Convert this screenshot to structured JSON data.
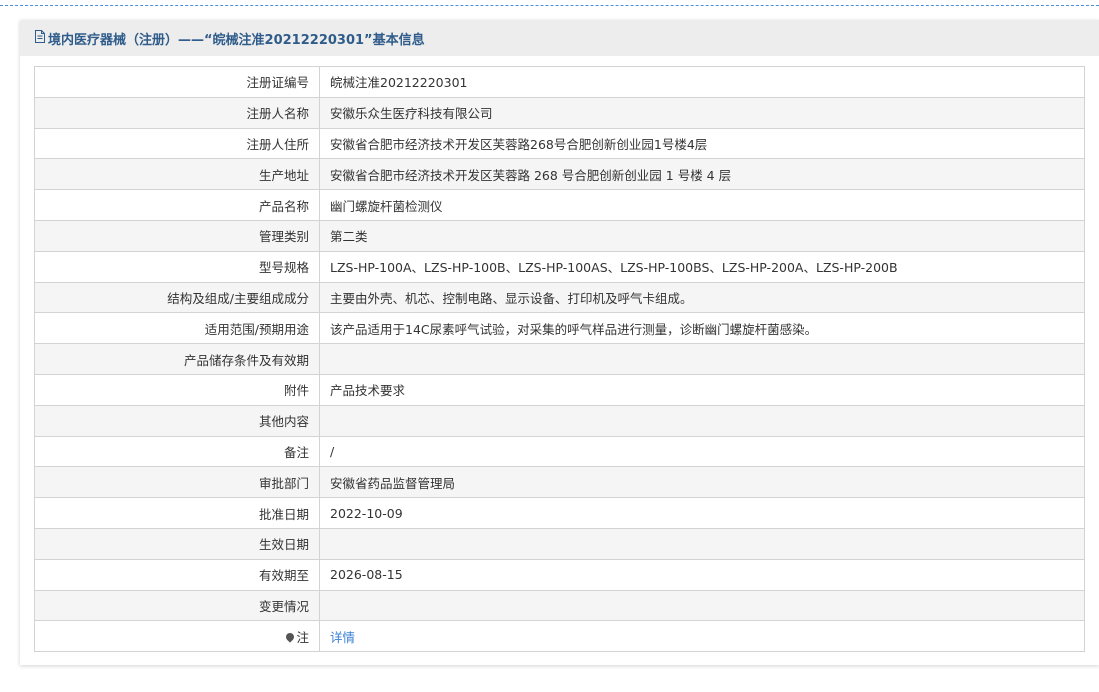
{
  "header": {
    "title": "境内医疗器械（注册）——“皖械注准20212220301”基本信息",
    "icon": "document-icon"
  },
  "rows": [
    {
      "label": "注册证编号",
      "value": "皖械注准20212220301"
    },
    {
      "label": "注册人名称",
      "value": "安徽乐众生医疗科技有限公司"
    },
    {
      "label": "注册人住所",
      "value": "安徽省合肥市经济技术开发区芙蓉路268号合肥创新创业园1号楼4层"
    },
    {
      "label": "生产地址",
      "value": "安徽省合肥市经济技术开发区芙蓉路 268 号合肥创新创业园 1 号楼 4 层"
    },
    {
      "label": "产品名称",
      "value": "幽门螺旋杆菌检测仪"
    },
    {
      "label": "管理类别",
      "value": "第二类"
    },
    {
      "label": "型号规格",
      "value": "LZS-HP-100A、LZS-HP-100B、LZS-HP-100AS、LZS-HP-100BS、LZS-HP-200A、LZS-HP-200B"
    },
    {
      "label": "结构及组成/主要组成成分",
      "value": "主要由外壳、机芯、控制电路、显示设备、打印机及呼气卡组成。"
    },
    {
      "label": "适用范围/预期用途",
      "value": "该产品适用于14C尿素呼气试验，对采集的呼气样品进行测量，诊断幽门螺旋杆菌感染。"
    },
    {
      "label": "产品储存条件及有效期",
      "value": ""
    },
    {
      "label": "附件",
      "value": "产品技术要求"
    },
    {
      "label": "其他内容",
      "value": ""
    },
    {
      "label": "备注",
      "value": "/"
    },
    {
      "label": "审批部门",
      "value": "安徽省药品监督管理局"
    },
    {
      "label": "批准日期",
      "value": "2022-10-09"
    },
    {
      "label": "生效日期",
      "value": ""
    },
    {
      "label": "有效期至",
      "value": "2026-08-15"
    },
    {
      "label": "变更情况",
      "value": ""
    },
    {
      "label": "注",
      "value": "详情"
    }
  ],
  "colors": {
    "header_text": "#2f5c8a",
    "link": "#3a7fd5"
  }
}
